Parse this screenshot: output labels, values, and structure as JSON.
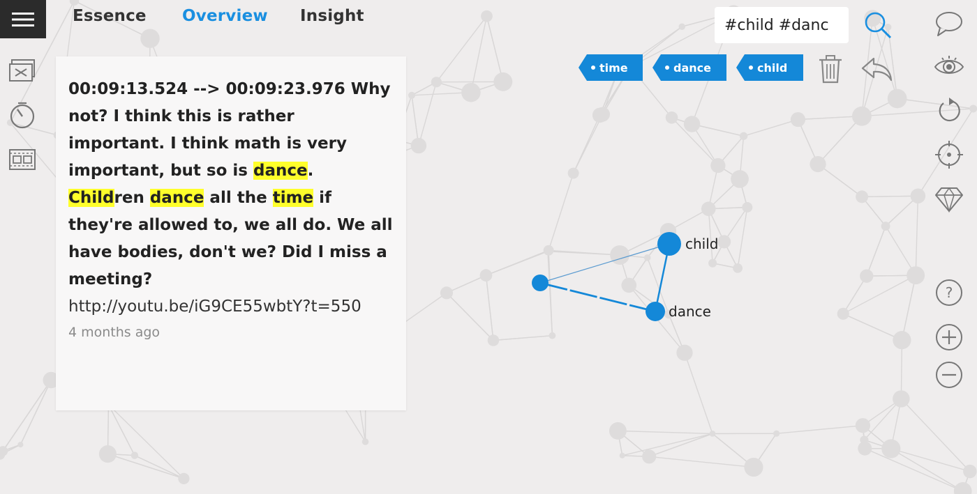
{
  "nav": {
    "tabs": [
      {
        "label": "Essence",
        "active": false
      },
      {
        "label": "Overview",
        "active": true
      },
      {
        "label": "Insight",
        "active": false
      }
    ]
  },
  "search": {
    "value": "#child #danc"
  },
  "filter_tags": [
    "time",
    "dance",
    "child"
  ],
  "card": {
    "timecode": "00:09:13.524 --> 00:09:23.976",
    "text_runs": [
      {
        "text": " Why not? I think this is rather important. I think math is very important, but so is ",
        "hl": false
      },
      {
        "text": "dance",
        "hl": true
      },
      {
        "text": ". ",
        "hl": false
      },
      {
        "text": "Child",
        "hl": true
      },
      {
        "text": "ren ",
        "hl": false
      },
      {
        "text": "dance",
        "hl": true
      },
      {
        "text": " all the ",
        "hl": false
      },
      {
        "text": "time",
        "hl": true
      },
      {
        "text": " if they're allowed to, we all do. We all have bodies, don't we? Did I miss a meeting?",
        "hl": false
      }
    ],
    "link": "http://youtu.be/iG9CE55wbtY?t=550",
    "timestamp": "4 months ago"
  },
  "graph": {
    "nodes": [
      {
        "id": "child",
        "label": "child"
      },
      {
        "id": "dance",
        "label": "dance"
      },
      {
        "id": "unlabeled",
        "label": ""
      }
    ],
    "edges": [
      [
        "child",
        "dance"
      ],
      [
        "unlabeled",
        "child"
      ],
      [
        "unlabeled",
        "dance"
      ]
    ]
  },
  "colors": {
    "accent": "#1a8fe0",
    "tag": "#1488d8",
    "highlight": "#ffff2b",
    "node": "#1488d8"
  },
  "icons": {
    "left": [
      "subtitles-icon",
      "timer-icon",
      "filmstrip-icon"
    ],
    "right": [
      "comment-icon",
      "eye-icon",
      "refresh-icon",
      "target-icon",
      "diamond-icon",
      "help-icon",
      "zoom-in-icon",
      "zoom-out-icon"
    ]
  }
}
